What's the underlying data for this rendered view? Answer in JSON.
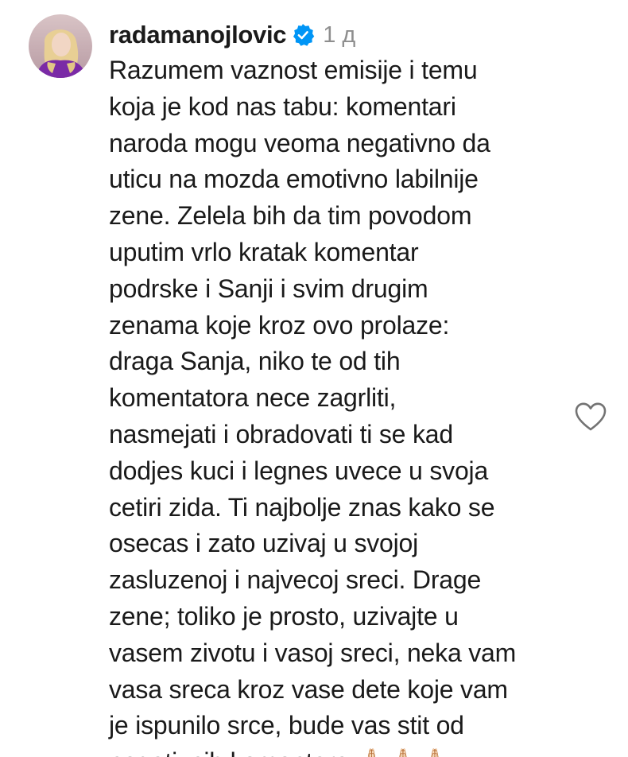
{
  "comment": {
    "username": "radamanojlovic",
    "verified": true,
    "time": "1 д",
    "lines": [
      "Razumem vaznost emisije i temu",
      "koja je kod nas tabu: komentari",
      "naroda mogu veoma negativno da",
      "uticu na mozda emotivno labilnije",
      "zene. Zelela bih da tim povodom",
      "uputim vrlo kratak komentar",
      "podrske i Sanji i svim drugim",
      "zenama koje kroz ovo prolaze:",
      "draga Sanja, niko te od tih",
      "komentatora nece zagrliti,",
      "nasmejati i obradovati ti se kad",
      "dodjes kuci i legnes uvece u svoja",
      "cetiri zida. Ti najbolje znas kako se",
      "osecas i zato uzivaj u svojoj",
      "zasluzenoj i najvecoj sreci. Drage",
      "zene; toliko je prosto, uzivajte u",
      "vasem zivotu i vasoj sreci, neka vam",
      "vasa sreca kroz vase dete koje vam",
      "je ispunilo srce, bude vas stit od",
      "negativnih komentara 🙏🏻🙏🏻🙏🏻"
    ]
  },
  "icons": {
    "verified": "verified-badge-icon",
    "like": "heart-outline-icon"
  },
  "colors": {
    "verified_blue": "#0095f6",
    "text": "#1a1a1a",
    "muted": "#8e8e8e"
  }
}
